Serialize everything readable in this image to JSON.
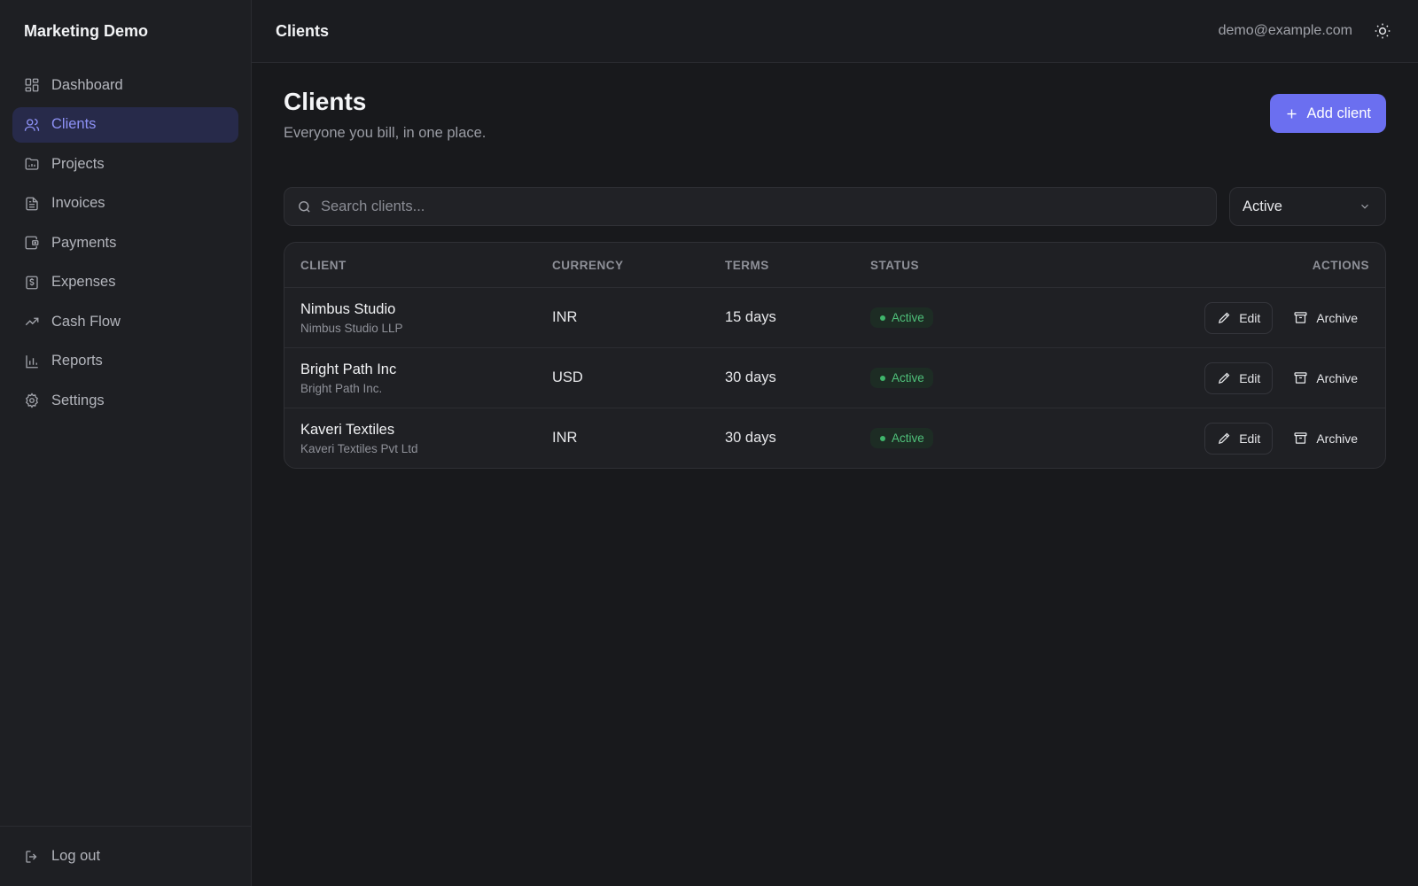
{
  "sidebar": {
    "brand": "Marketing Demo",
    "items": [
      {
        "label": "Dashboard",
        "icon": "dashboard-icon"
      },
      {
        "label": "Clients",
        "icon": "users-icon",
        "active": true
      },
      {
        "label": "Projects",
        "icon": "folder-icon"
      },
      {
        "label": "Invoices",
        "icon": "document-icon"
      },
      {
        "label": "Payments",
        "icon": "wallet-icon"
      },
      {
        "label": "Expenses",
        "icon": "receipt-icon"
      },
      {
        "label": "Cash Flow",
        "icon": "trend-icon"
      },
      {
        "label": "Reports",
        "icon": "bar-chart-icon"
      },
      {
        "label": "Settings",
        "icon": "gear-icon"
      }
    ],
    "logout_label": "Log out"
  },
  "topbar": {
    "title": "Clients",
    "user_email": "demo@example.com"
  },
  "page": {
    "title": "Clients",
    "subtitle": "Everyone you bill, in one place.",
    "add_label": "Add client"
  },
  "filters": {
    "search_placeholder": "Search clients...",
    "status_value": "Active"
  },
  "table": {
    "headers": {
      "client": "CLIENT",
      "currency": "CURRENCY",
      "terms": "TERMS",
      "status": "STATUS",
      "actions": "ACTIONS"
    },
    "rows": [
      {
        "name": "Nimbus Studio",
        "legal": "Nimbus Studio LLP",
        "currency": "INR",
        "terms": "15 days",
        "status": "Active",
        "edit": "Edit",
        "archive": "Archive"
      },
      {
        "name": "Bright Path Inc",
        "legal": "Bright Path Inc.",
        "currency": "USD",
        "terms": "30 days",
        "status": "Active",
        "edit": "Edit",
        "archive": "Archive"
      },
      {
        "name": "Kaveri Textiles",
        "legal": "Kaveri Textiles Pvt Ltd",
        "currency": "INR",
        "terms": "30 days",
        "status": "Active",
        "edit": "Edit",
        "archive": "Archive"
      }
    ]
  },
  "colors": {
    "accent": "#6b6ff0",
    "active_nav_bg": "#272a4a",
    "active_nav_text": "#8d91f5",
    "status_active": "#4fc07a"
  }
}
